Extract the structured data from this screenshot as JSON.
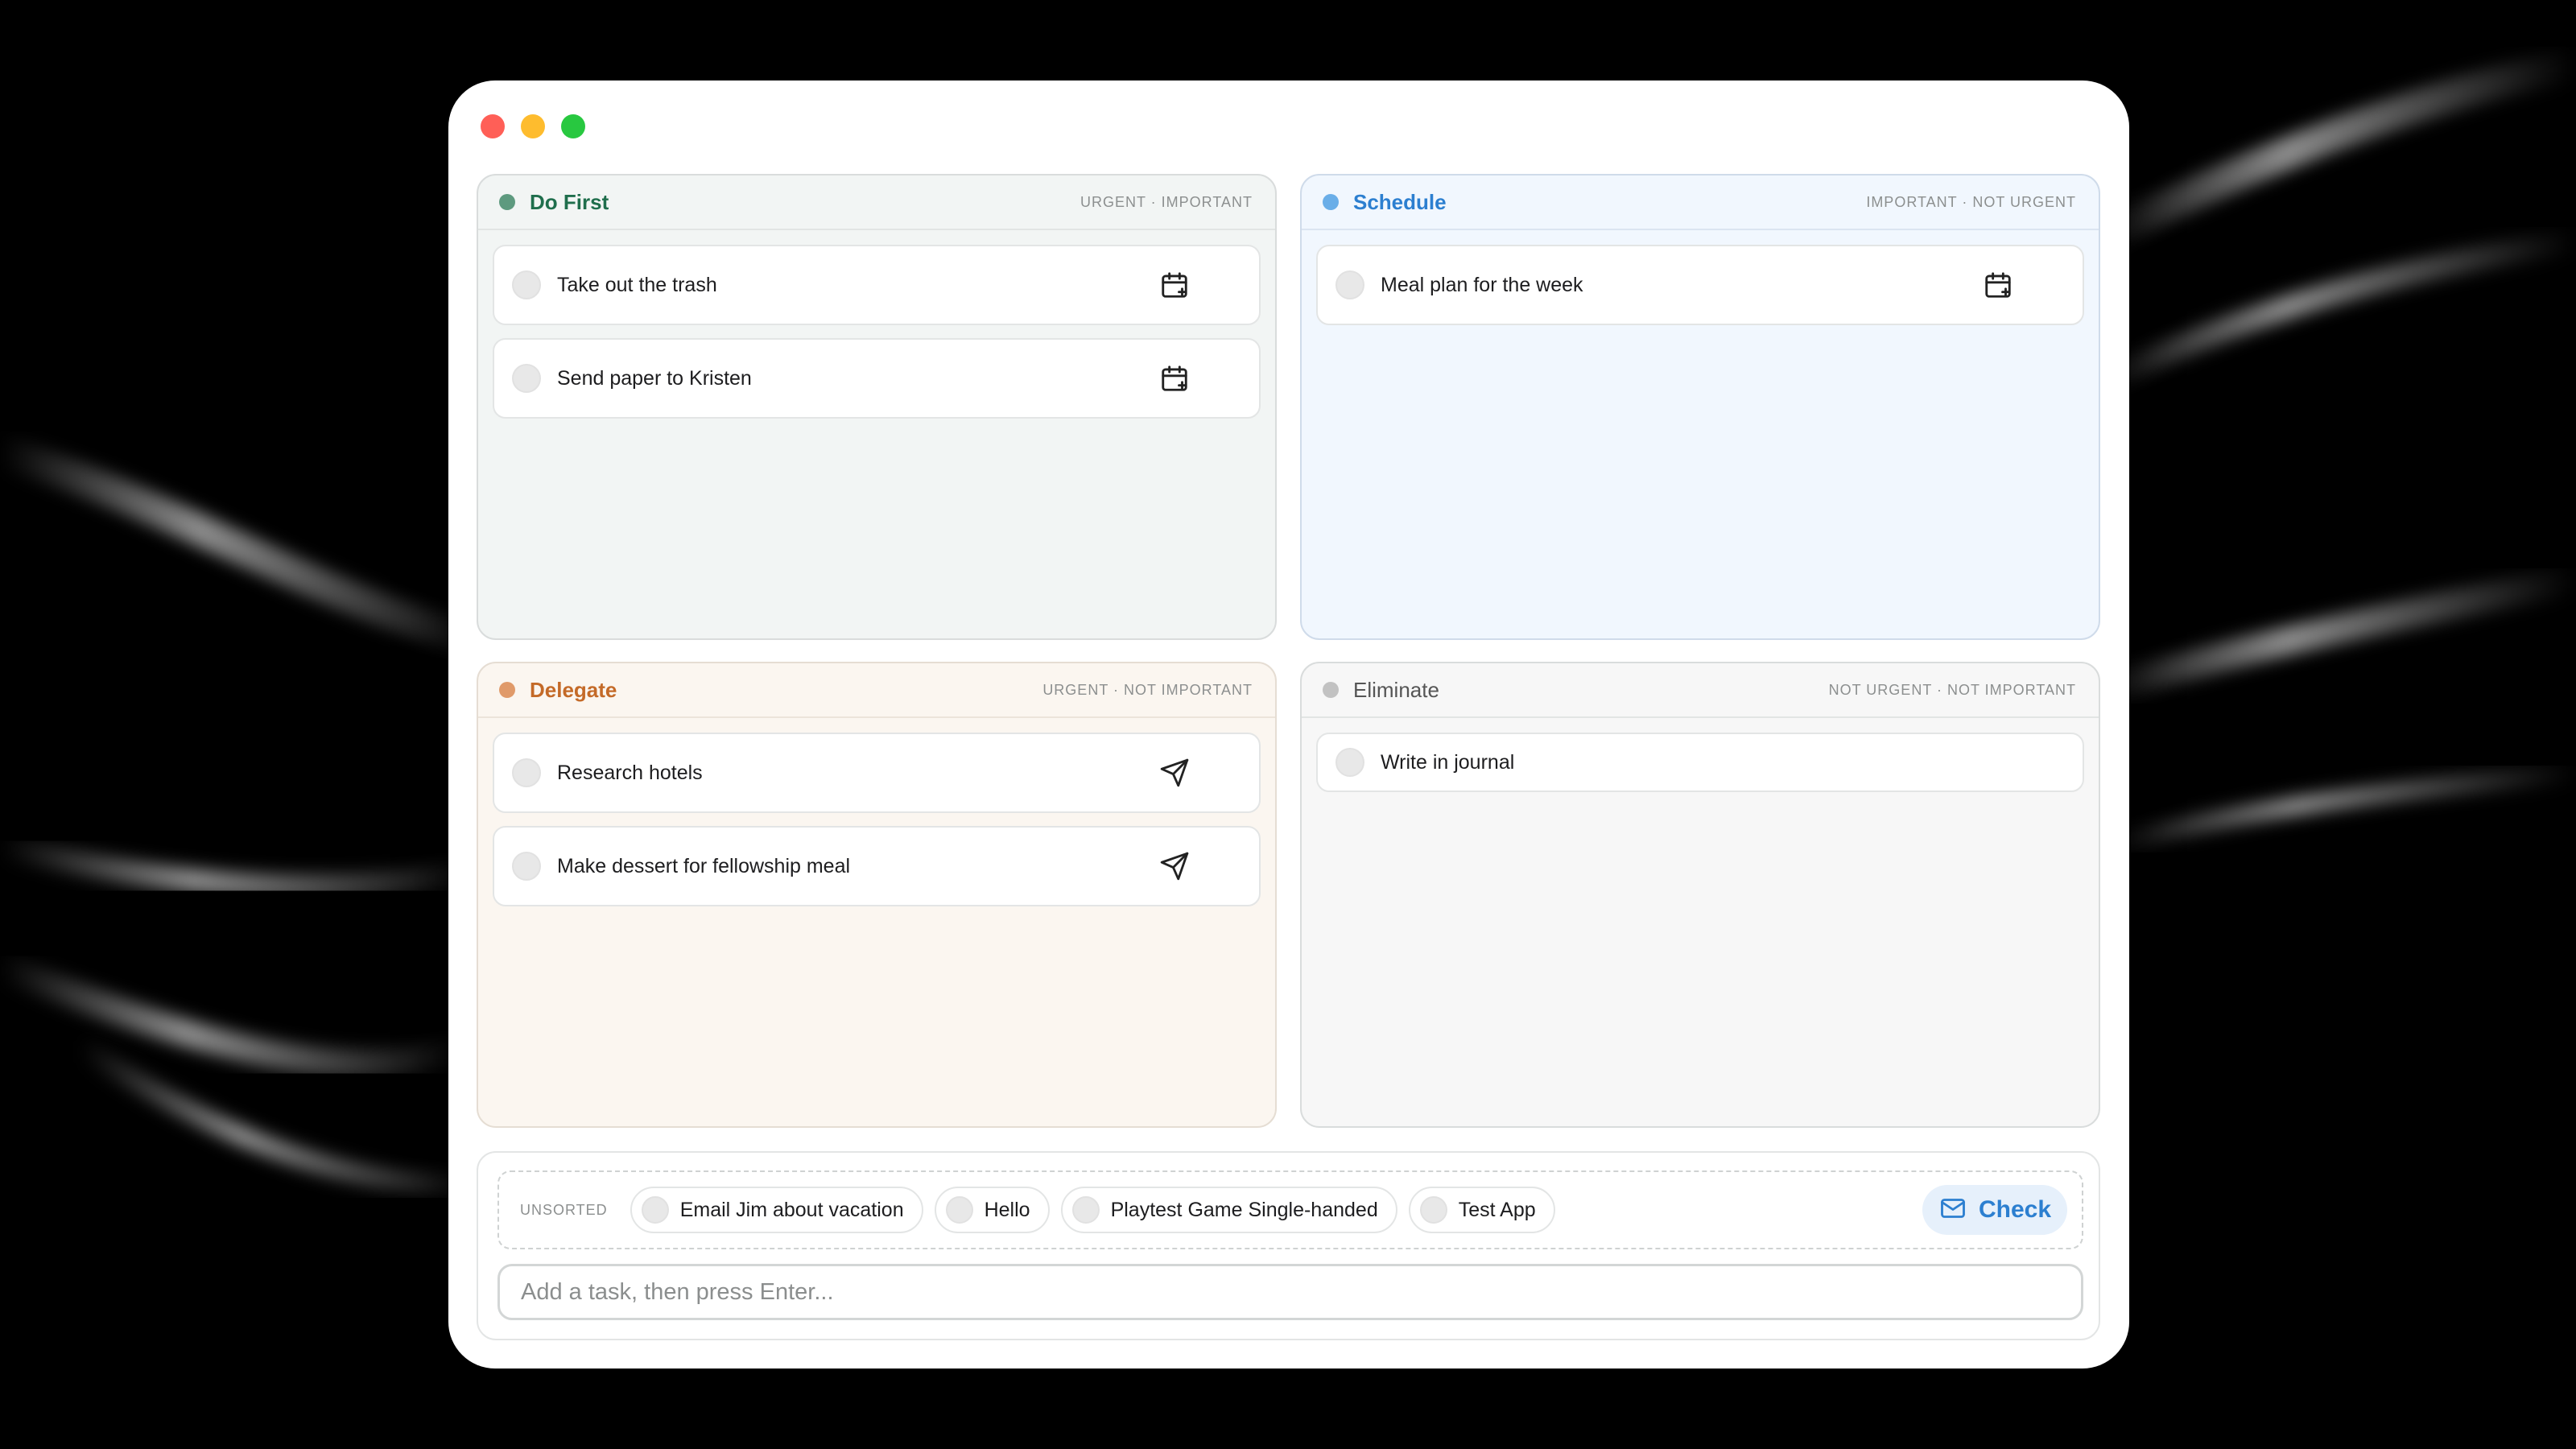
{
  "colors": {
    "do_first": "#5e9a7f",
    "schedule": "#6aaee8",
    "delegate": "#e09a6a",
    "eliminate": "#c2c2c2",
    "do_first_title": "#1f6e4c",
    "schedule_title": "#2c7fd0",
    "delegate_title": "#c46a28",
    "eliminate_title": "#555555"
  },
  "quadrants": {
    "do_first": {
      "title": "Do First",
      "subtitle": "URGENT · IMPORTANT",
      "tasks": [
        {
          "label": "Take out the trash",
          "icon": "calendar-plus-icon"
        },
        {
          "label": "Send paper to Kristen",
          "icon": "calendar-plus-icon"
        }
      ]
    },
    "schedule": {
      "title": "Schedule",
      "subtitle": "IMPORTANT · NOT URGENT",
      "tasks": [
        {
          "label": "Meal plan for the week",
          "icon": "calendar-plus-icon"
        }
      ]
    },
    "delegate": {
      "title": "Delegate",
      "subtitle": "URGENT · NOT IMPORTANT",
      "tasks": [
        {
          "label": "Research hotels",
          "icon": "send-icon"
        },
        {
          "label": "Make dessert for fellowship meal",
          "icon": "send-icon"
        }
      ]
    },
    "eliminate": {
      "title": "Eliminate",
      "subtitle": "NOT URGENT · NOT IMPORTANT",
      "tasks": [
        {
          "label": "Write in journal"
        }
      ]
    }
  },
  "unsorted": {
    "label": "UNSORTED",
    "items": [
      "Email Jim about vacation",
      "Hello",
      "Playtest Game Single-handed",
      "Test App"
    ],
    "check_button": "Check"
  },
  "add_task": {
    "placeholder": "Add a task, then press Enter..."
  }
}
